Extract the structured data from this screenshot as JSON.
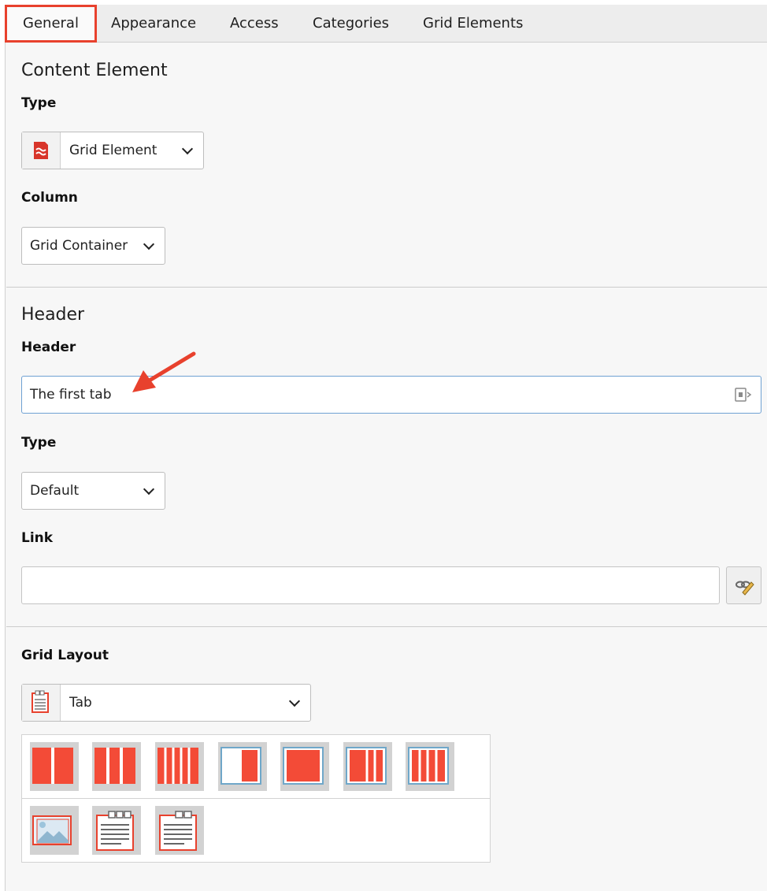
{
  "tabs": [
    {
      "label": "General",
      "active": true
    },
    {
      "label": "Appearance",
      "active": false
    },
    {
      "label": "Access",
      "active": false
    },
    {
      "label": "Categories",
      "active": false
    },
    {
      "label": "Grid Elements",
      "active": false
    }
  ],
  "content_element": {
    "section_title": "Content Element",
    "type_label": "Type",
    "type_value": "Grid Element",
    "column_label": "Column",
    "column_value": "Grid Container"
  },
  "header": {
    "section_title": "Header",
    "header_label": "Header",
    "header_value": "The first tab",
    "type_label": "Type",
    "type_value": "Default",
    "link_label": "Link",
    "link_value": ""
  },
  "grid_layout": {
    "label": "Grid Layout",
    "value": "Tab",
    "row1_icons": [
      "2-columns-icon",
      "3-columns-icon",
      "4-columns-icon",
      "1-column-narrow-icon",
      "1-column-wide-icon",
      "3-columns-wide-icon",
      "4-columns-wide-icon"
    ],
    "row2_icons": [
      "image-icon",
      "tab-document-icon",
      "accordion-document-icon"
    ]
  },
  "colors": {
    "accent": "#e8412d",
    "grid_red": "#f34b37",
    "focus_border": "#6fa1d3"
  }
}
